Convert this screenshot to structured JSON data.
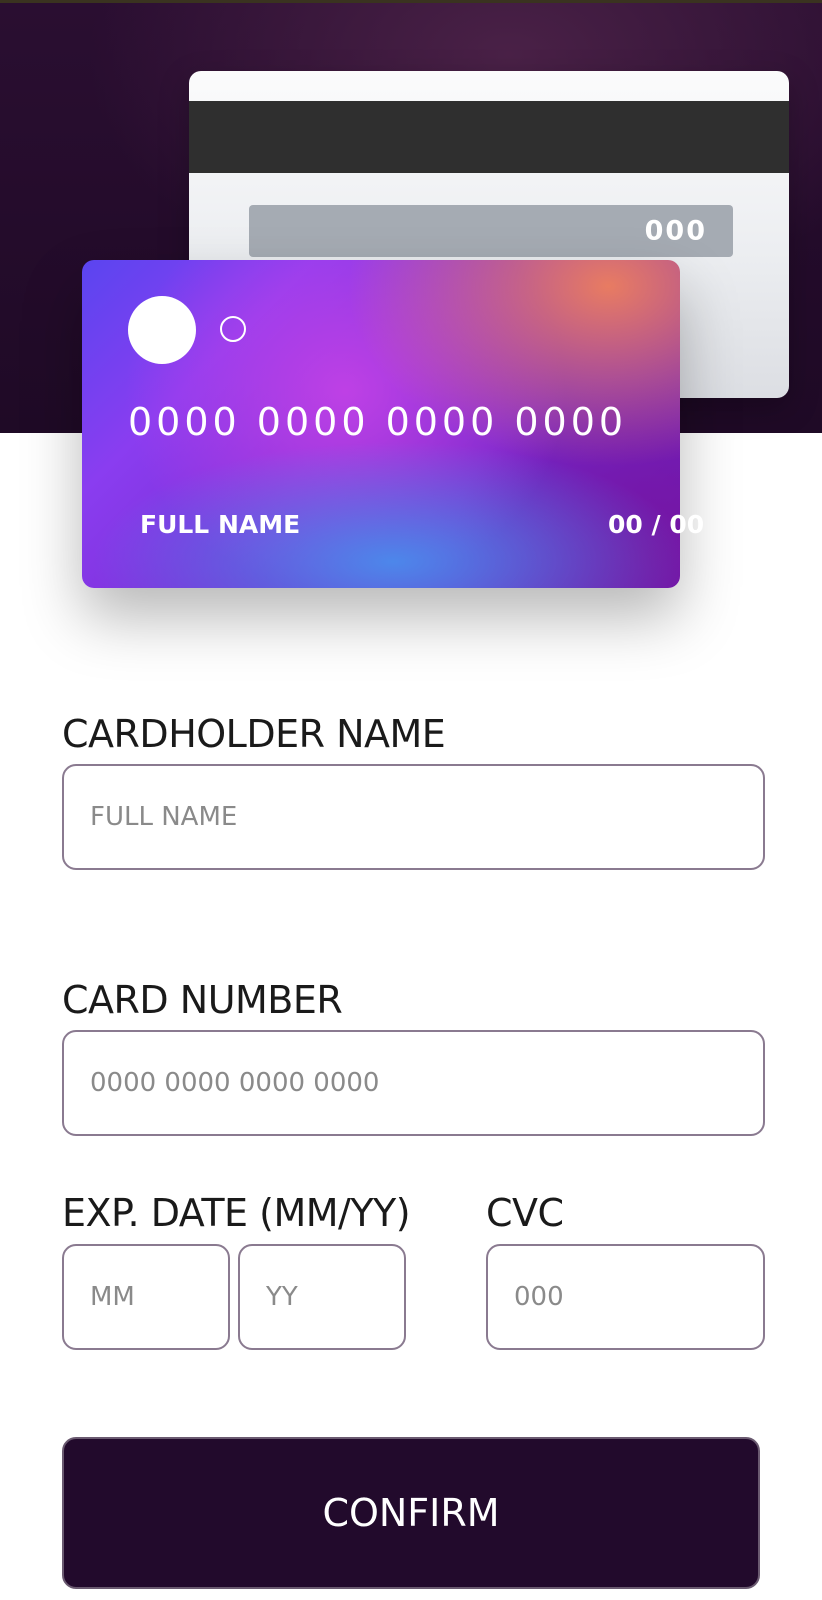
{
  "card_preview": {
    "back_cvc": "000",
    "front_number": "0000 0000 0000 0000",
    "front_name": "FULL NAME",
    "front_exp": "00 / 00"
  },
  "form": {
    "cardholder": {
      "label": "CARDHOLDER NAME",
      "placeholder": "FULL NAME",
      "value": ""
    },
    "card_number": {
      "label": "CARD NUMBER",
      "placeholder": "0000 0000 0000 0000",
      "value": ""
    },
    "exp_date": {
      "label": "EXP. DATE (MM/YY)",
      "month_placeholder": "MM",
      "year_placeholder": "YY"
    },
    "cvc": {
      "label": "CVC",
      "placeholder": "000"
    },
    "confirm_label": "CONFIRM"
  },
  "colors": {
    "hero_background": "#220a2c",
    "confirm_button": "#220a2c",
    "input_border": "#8a7a90",
    "card_gradient_start": "#5a45f0",
    "card_gradient_end": "#6a18b0"
  }
}
